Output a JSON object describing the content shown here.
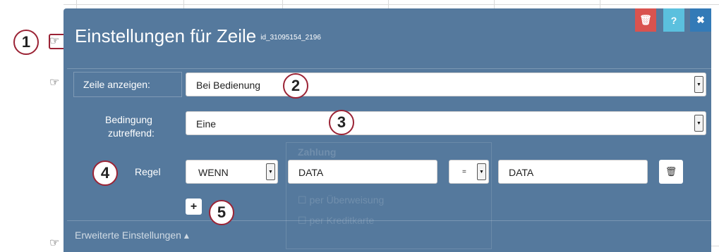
{
  "header": {
    "title": "Einstellungen für Zeile",
    "row_id": "id_31095154_2196",
    "colors": {
      "delete": "#d9534f",
      "help": "#5bc0de",
      "close": "#337ab7",
      "dialog": "#55799d",
      "callout_border": "#9b2335"
    },
    "icons": {
      "delete": "trash-icon",
      "help": "question-icon",
      "close": "close-icon"
    },
    "help_label": "?",
    "close_label": "✖"
  },
  "form": {
    "show_row_label": "Zeile anzeigen:",
    "show_row_value": "Bei Bedienung",
    "condition_label_line1": "Bedingung",
    "condition_label_line2": "zutreffend:",
    "condition_value": "Eine",
    "rule_label": "Regel",
    "rule_type_value": "WENN",
    "rule_left_value": "DATA",
    "rule_operator_value": "=",
    "rule_right_value": "DATA",
    "add_rule_label": "+"
  },
  "footer": {
    "advanced_label": "Erweiterte Einstellungen ▴"
  },
  "background": {
    "section_title": "Zahlung",
    "option1": "per Überweisung",
    "option2": "per Kreditkarte"
  },
  "callouts": [
    "1",
    "2",
    "3",
    "4",
    "5"
  ]
}
